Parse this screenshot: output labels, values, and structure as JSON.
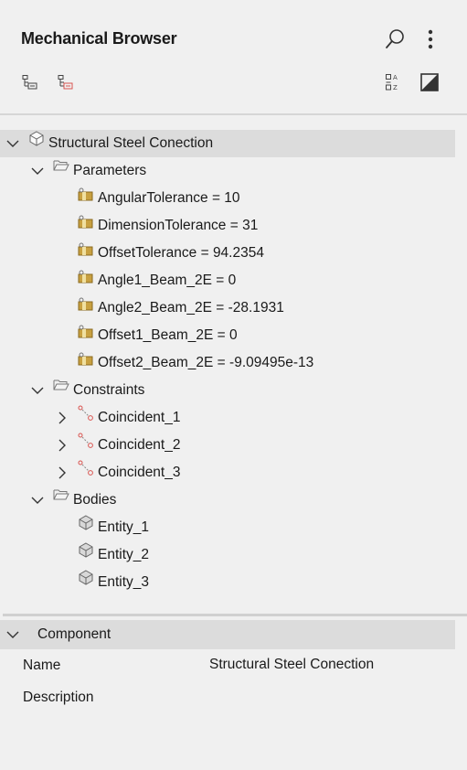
{
  "panel": {
    "title": "Mechanical Browser"
  },
  "toolbar": {
    "search_icon": "search-icon",
    "more_icon": "more-vert-icon",
    "colors": {
      "accent_red": "#d9534f",
      "icon_gray": "#555555",
      "folder_gray": "#7a7a7a",
      "param_gold": "#c8a040"
    }
  },
  "tree": {
    "root": {
      "label": "Structural Steel Conection"
    },
    "parameters": {
      "label": "Parameters",
      "items": [
        "AngularTolerance = 10",
        "DimensionTolerance = 31",
        "OffsetTolerance = 94.2354",
        "Angle1_Beam_2E = 0",
        "Angle2_Beam_2E = -28.1931",
        "Offset1_Beam_2E = 0",
        "Offset2_Beam_2E = -9.09495e-13"
      ]
    },
    "constraints": {
      "label": "Constraints",
      "items": [
        "Coincident_1",
        "Coincident_2",
        "Coincident_3"
      ]
    },
    "bodies": {
      "label": "Bodies",
      "items": [
        "Entity_1",
        "Entity_2",
        "Entity_3"
      ]
    }
  },
  "component": {
    "header": "Component",
    "properties": [
      {
        "label": "Name",
        "value": "Structural Steel Conection"
      },
      {
        "label": "Description",
        "value": ""
      }
    ]
  }
}
